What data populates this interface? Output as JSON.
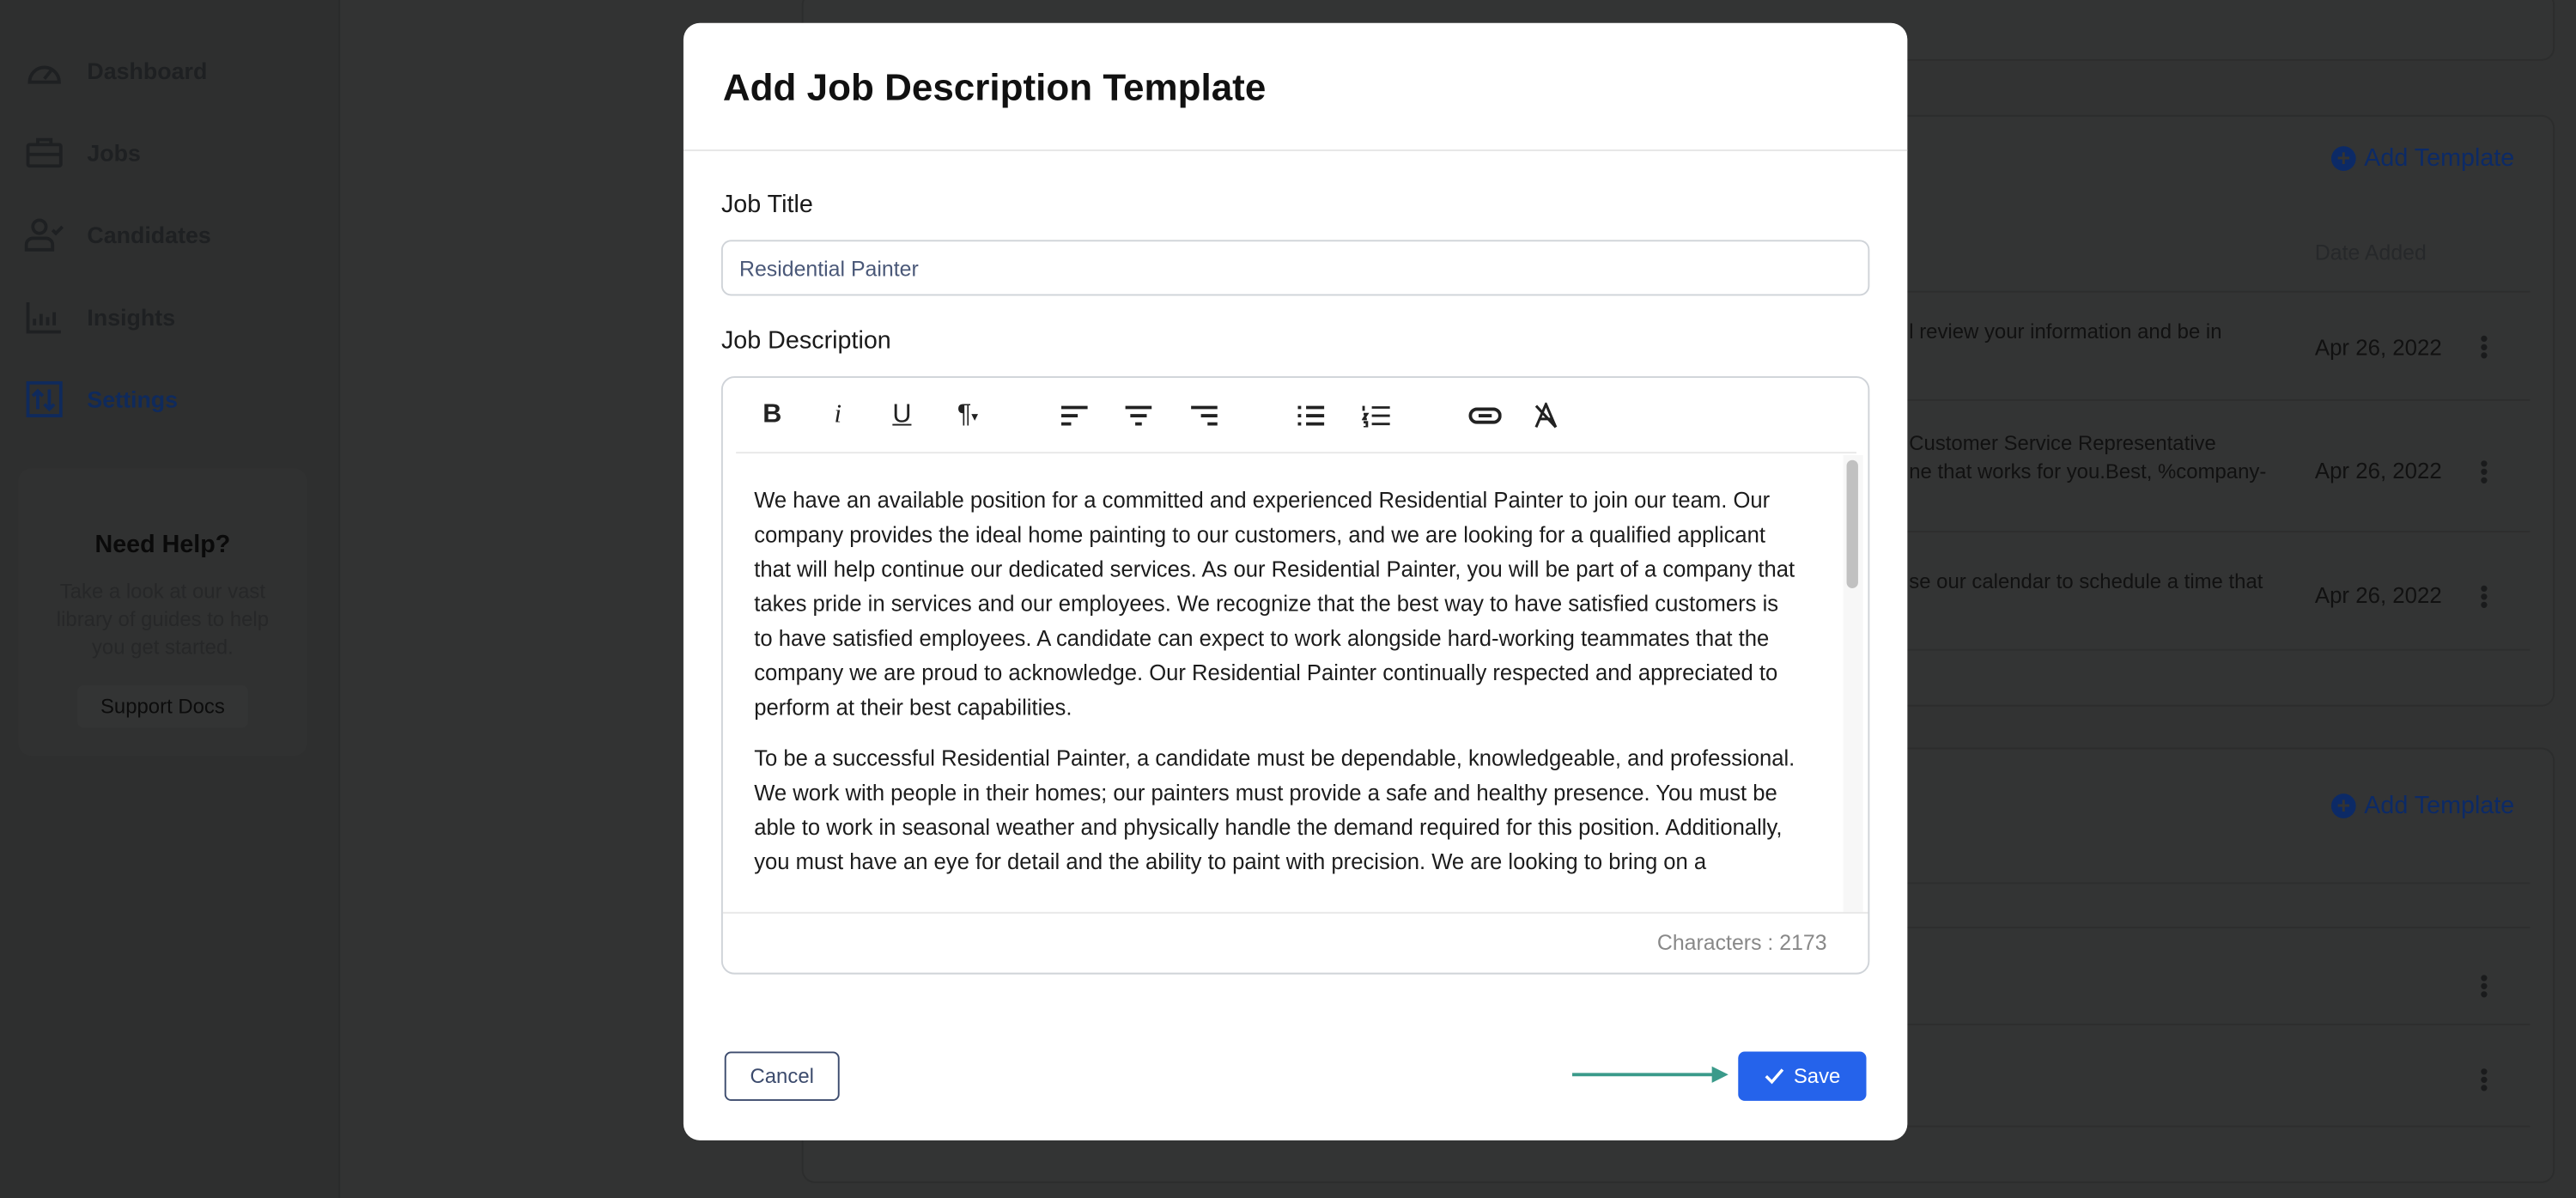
{
  "sidebar": {
    "items": [
      {
        "label": "Dashboard",
        "icon": "gauge-icon"
      },
      {
        "label": "Jobs",
        "icon": "briefcase-icon"
      },
      {
        "label": "Candidates",
        "icon": "user-check-icon"
      },
      {
        "label": "Insights",
        "icon": "bar-chart-icon"
      },
      {
        "label": "Settings",
        "icon": "sliders-icon",
        "active": true
      }
    ],
    "help": {
      "title": "Need Help?",
      "text": "Take a look at our vast library of guides to help you get started.",
      "button": "Support Docs"
    }
  },
  "background": {
    "add_template": "Add Template",
    "date_header": "Date Added",
    "rows": [
      {
        "text": [
          "l review your information and be in"
        ],
        "date": "Apr 26, 2022"
      },
      {
        "text": [
          "Customer Service Representative",
          "ne that works for you.Best, %company-"
        ],
        "date": "Apr 26, 2022"
      },
      {
        "text": [
          "se our calendar to schedule a time that"
        ],
        "date": "Apr 26, 2022"
      }
    ]
  },
  "modal": {
    "title": "Add Job Description Template",
    "job_title_label": "Job Title",
    "job_title_value": "Residential Painter",
    "job_description_label": "Job Description",
    "toolbar": [
      "bold-icon",
      "italic-icon",
      "underline-icon",
      "paragraph-icon",
      "align-left-icon",
      "align-center-icon",
      "align-right-icon",
      "bullet-list-icon",
      "numbered-list-icon",
      "link-icon",
      "clear-format-icon"
    ],
    "paragraphs": [
      [
        "We have an available position for a committed and experienced Residential Painter to join our team. Our",
        "company provides the ideal home painting to our customers, and we are looking for a qualified applicant",
        "that will help continue our dedicated services. As our Residential Painter, you will be part of a company that",
        "takes pride in services and our employees. We recognize that the best way to have satisfied customers is",
        "to have satisfied employees. A candidate can expect to work alongside hard-working teammates that the",
        "company we are proud to acknowledge. Our Residential Painter continually respected and appreciated to",
        "perform at their best capabilities."
      ],
      [
        "To be a successful Residential Painter, a candidate must be dependable, knowledgeable, and professional.",
        "We work with people in their homes; our painters must provide a safe and healthy presence. You must be",
        "able to work in seasonal weather and physically handle the demand required for this position. Additionally,",
        "you must have an eye for detail and the ability to paint with precision. We are looking to bring on a"
      ]
    ],
    "characters": "Characters : 2173",
    "cancel": "Cancel",
    "save": "Save"
  },
  "colors": {
    "primary": "#2563eb",
    "arrow": "#3a9a8a",
    "nav_active": "#0f2a5c"
  }
}
